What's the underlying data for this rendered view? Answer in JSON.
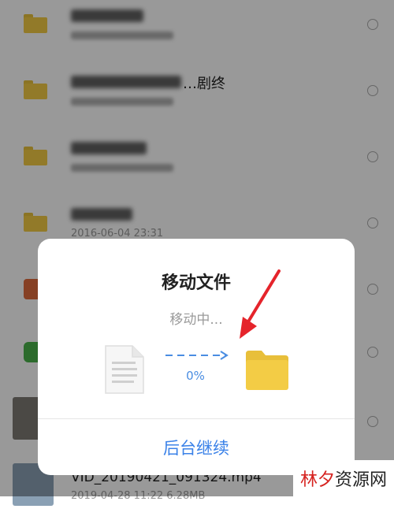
{
  "file_list": {
    "rows": [
      {
        "name": "",
        "date": ""
      },
      {
        "name": "…剧终",
        "date": ""
      },
      {
        "name": "",
        "date": ""
      },
      {
        "name": "",
        "date": "2016-06-04  23:31"
      },
      {
        "name": "",
        "date": ""
      },
      {
        "name": "",
        "date": ""
      },
      {
        "name": "",
        "date": ""
      },
      {
        "name": "VID_20190421_091324.mp4",
        "date": "2019-04-28  11:22   6.28MB"
      }
    ]
  },
  "dialog": {
    "title": "移动文件",
    "status": "移动中...",
    "progress": "0%",
    "continue_label": "后台继续"
  },
  "watermark": {
    "part1": "林夕",
    "part2": "资源网"
  },
  "colors": {
    "accent": "#3b82e8",
    "folder": "#f3cc45",
    "annotation": "#e5242b"
  },
  "icons": {
    "document": "document-icon",
    "folder": "folder-icon",
    "arrow": "dashed-arrow-right-icon"
  }
}
